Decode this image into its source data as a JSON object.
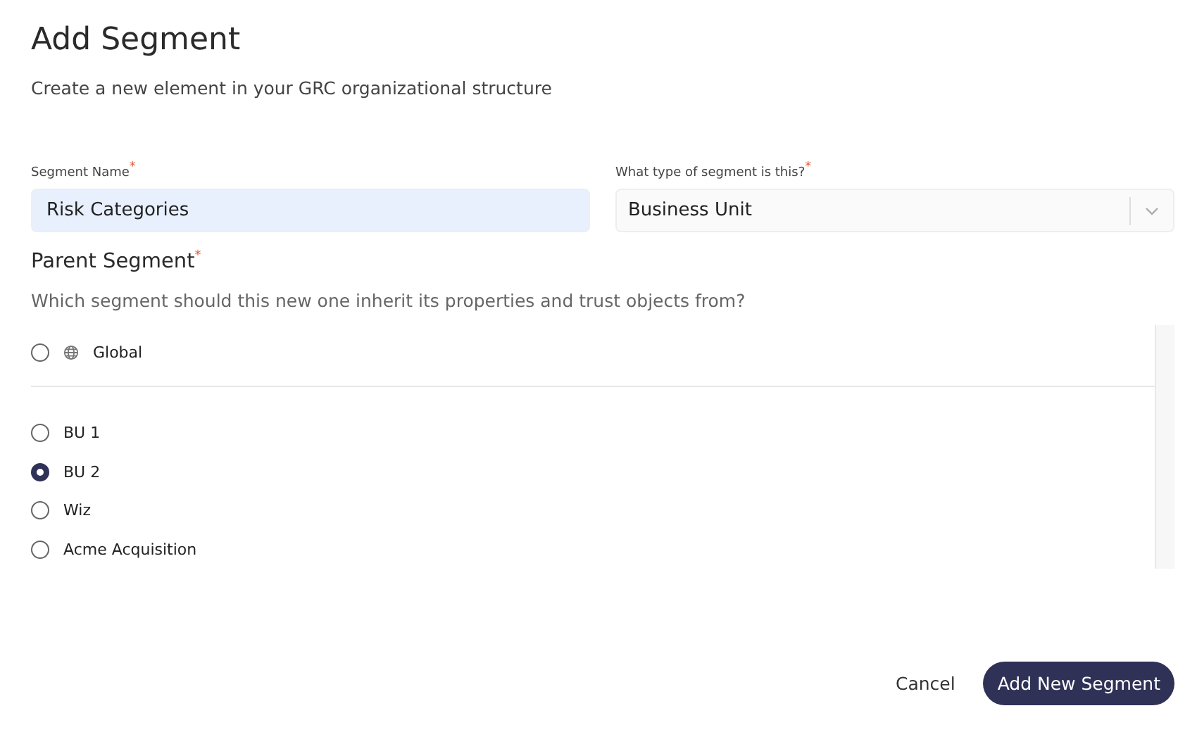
{
  "title": "Add Segment",
  "subtitle": "Create a new element in your GRC organizational structure",
  "fields": [
    {
      "kind": "text",
      "label": "Segment Name",
      "required_mark": "*",
      "value": "Risk Categories"
    },
    {
      "kind": "select",
      "label": "What type of segment is this?",
      "required_mark": "*",
      "value": "Business Unit"
    }
  ],
  "parent_segment": {
    "label": "Parent Segment",
    "required_mark": "*",
    "hint": "Which segment should this new one inherit its properties and trust objects from?",
    "options": [
      {
        "kind": "global",
        "label": "Global",
        "selected": false
      },
      {
        "kind": "segment",
        "label": "BU 1",
        "selected": false
      },
      {
        "kind": "segment",
        "label": "BU 2",
        "selected": true
      },
      {
        "kind": "segment",
        "label": "Wiz",
        "selected": false
      },
      {
        "kind": "segment",
        "label": "Acme Acquisition",
        "selected": false
      }
    ]
  },
  "buttons": [
    {
      "kind": "secondary",
      "label": "Cancel"
    },
    {
      "kind": "primary",
      "label": "Add New Segment"
    }
  ]
}
